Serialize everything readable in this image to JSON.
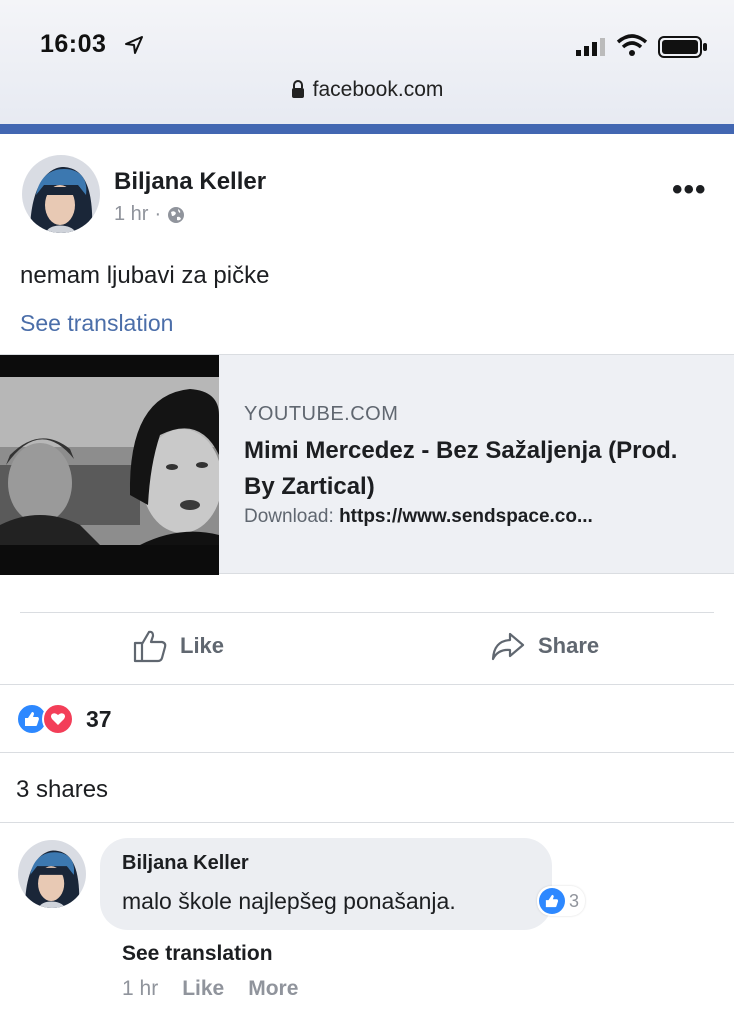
{
  "status_bar": {
    "time": "16:03"
  },
  "browser": {
    "url": "facebook.com"
  },
  "post": {
    "author": "Biljana Keller",
    "time": "1 hr",
    "separator": "·",
    "privacy_icon": "globe-icon",
    "text": "nemam ljubavi za pičke",
    "see_translation": "See translation",
    "more_label": "•••"
  },
  "link_preview": {
    "domain": "YOUTUBE.COM",
    "title": "Mimi Mercedez - Bez Sažaljenja (Prod. By Zartical)",
    "desc_prefix": "Download: ",
    "desc_link": "https://www.sendspace.co..."
  },
  "actions": {
    "like": "Like",
    "share": "Share"
  },
  "reactions": {
    "types": [
      "like",
      "love"
    ],
    "count": "37"
  },
  "shares": "3 shares",
  "comment": {
    "author": "Biljana Keller",
    "text": "malo škole najlepšeg ponašanja.",
    "reaction_count": "3",
    "see_translation": "See translation",
    "time": "1 hr",
    "like": "Like",
    "more": "More"
  },
  "colors": {
    "brand_blue": "#4267b2",
    "link_blue": "#4b6ea9",
    "like_blue": "#2d88ff",
    "love_red": "#f33e58"
  }
}
